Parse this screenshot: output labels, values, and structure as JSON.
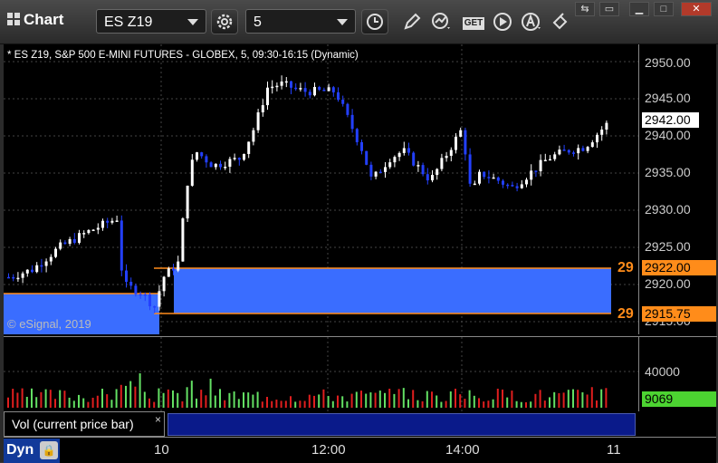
{
  "toolbar": {
    "title": "Chart",
    "symbol_value": "ES Z19",
    "interval_value": "5",
    "buttons": [
      "settings-icon",
      "clock-icon",
      "pencil-icon",
      "study-icon",
      "get-icon",
      "play-icon",
      "alert-icon",
      "paint-icon"
    ],
    "get_label": "GET"
  },
  "chart": {
    "symbol_line": "* ES Z19, S&P 500 E-MINI FUTURES - GLOBEX, 5, 09:30-16:15 (Dynamic)",
    "copyright": "© eSignal, 2019",
    "price_ticks": [
      "2950.00",
      "2945.00",
      "2940.00",
      "2935.00",
      "2930.00",
      "2925.00",
      "2920.00",
      "2915.00"
    ],
    "last_price_tag": "2942.00",
    "upper_level_tag": "2922.00",
    "lower_level_tag": "2915.75",
    "upper_left_label": "29",
    "lower_left_label": "29",
    "colors": {
      "up": "#ffffff",
      "down": "#2340ff",
      "zone": "#3a6dff",
      "level": "#ff8c1a",
      "vol_up": "#63e063",
      "vol_down": "#e01e1e"
    }
  },
  "volume": {
    "tick": "40000",
    "current_tag": "9069",
    "panel_label": "Vol (current price bar)",
    "close_glyph": "×"
  },
  "time_axis": {
    "labels": [
      "10",
      "12:00",
      "14:00",
      "11"
    ],
    "dyn_label": "Dyn"
  }
}
